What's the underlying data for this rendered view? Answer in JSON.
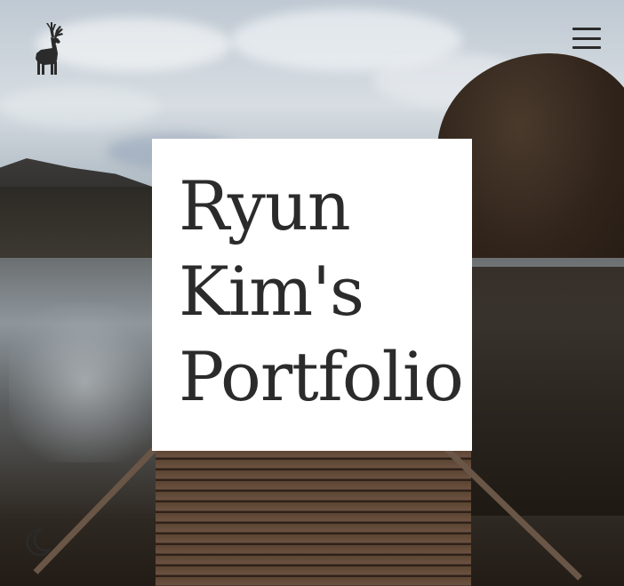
{
  "header": {
    "logo_icon": "deer-silhouette-icon",
    "menu_icon": "hamburger-menu-icon"
  },
  "hero": {
    "title": "Ryun Kim's Portfolio"
  },
  "footer": {
    "theme_toggle_icon": "moon-icon"
  },
  "colors": {
    "title_text": "#2b2b2b",
    "card_background": "#ffffff",
    "icon": "#2b2b2b"
  }
}
